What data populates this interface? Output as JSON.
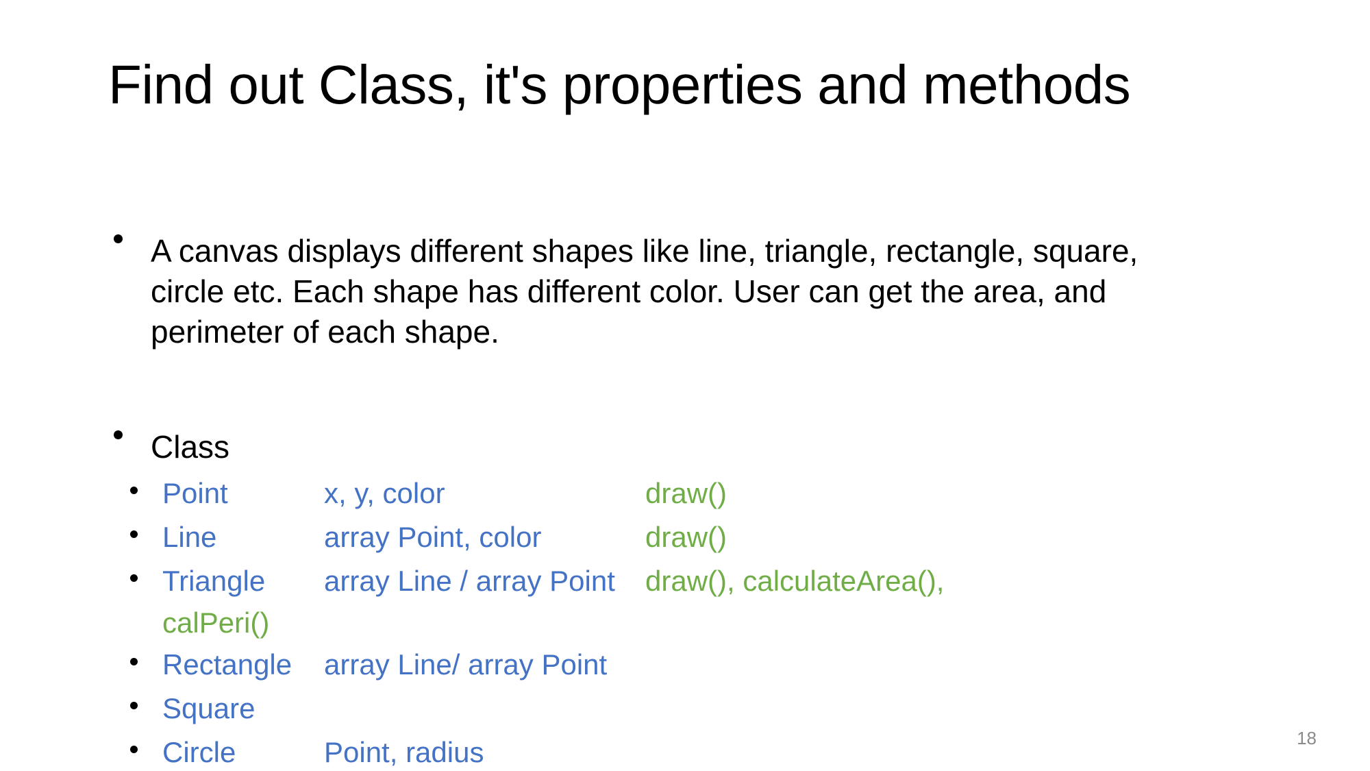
{
  "slide": {
    "title": "Find out Class, it's properties and methods",
    "page_number": "18",
    "background_color": "#FFFFFF"
  },
  "colors": {
    "title_text": "#000000",
    "body_text": "#000000",
    "class_blue": "#4472C4",
    "method_green": "#70AD47",
    "page_number_gray": "#8A8A8A"
  },
  "body": {
    "bullets": [
      {
        "text": "A canvas displays different shapes like line, triangle, rectangle, square, circle etc. Each shape has different color. User can get the area, and perimeter of each shape."
      },
      {
        "text": "Class"
      }
    ]
  },
  "class_table": {
    "rows": [
      {
        "name": "Point",
        "properties": "x, y, color",
        "methods": "draw()",
        "methods_continued": ""
      },
      {
        "name": "Line",
        "properties": "array Point, color",
        "methods": "draw()",
        "methods_continued": ""
      },
      {
        "name": "Triangle",
        "properties": "array Line / array Point",
        "methods": "draw(), calculateArea(),",
        "methods_continued": "calPeri()"
      },
      {
        "name": "Rectangle",
        "properties": "array Line/ array Point",
        "methods": "",
        "methods_continued": ""
      },
      {
        "name": "Square",
        "properties": "",
        "methods": "",
        "methods_continued": ""
      },
      {
        "name": "Circle",
        "properties": "Point, radius",
        "methods": "",
        "methods_continued": ""
      }
    ]
  }
}
